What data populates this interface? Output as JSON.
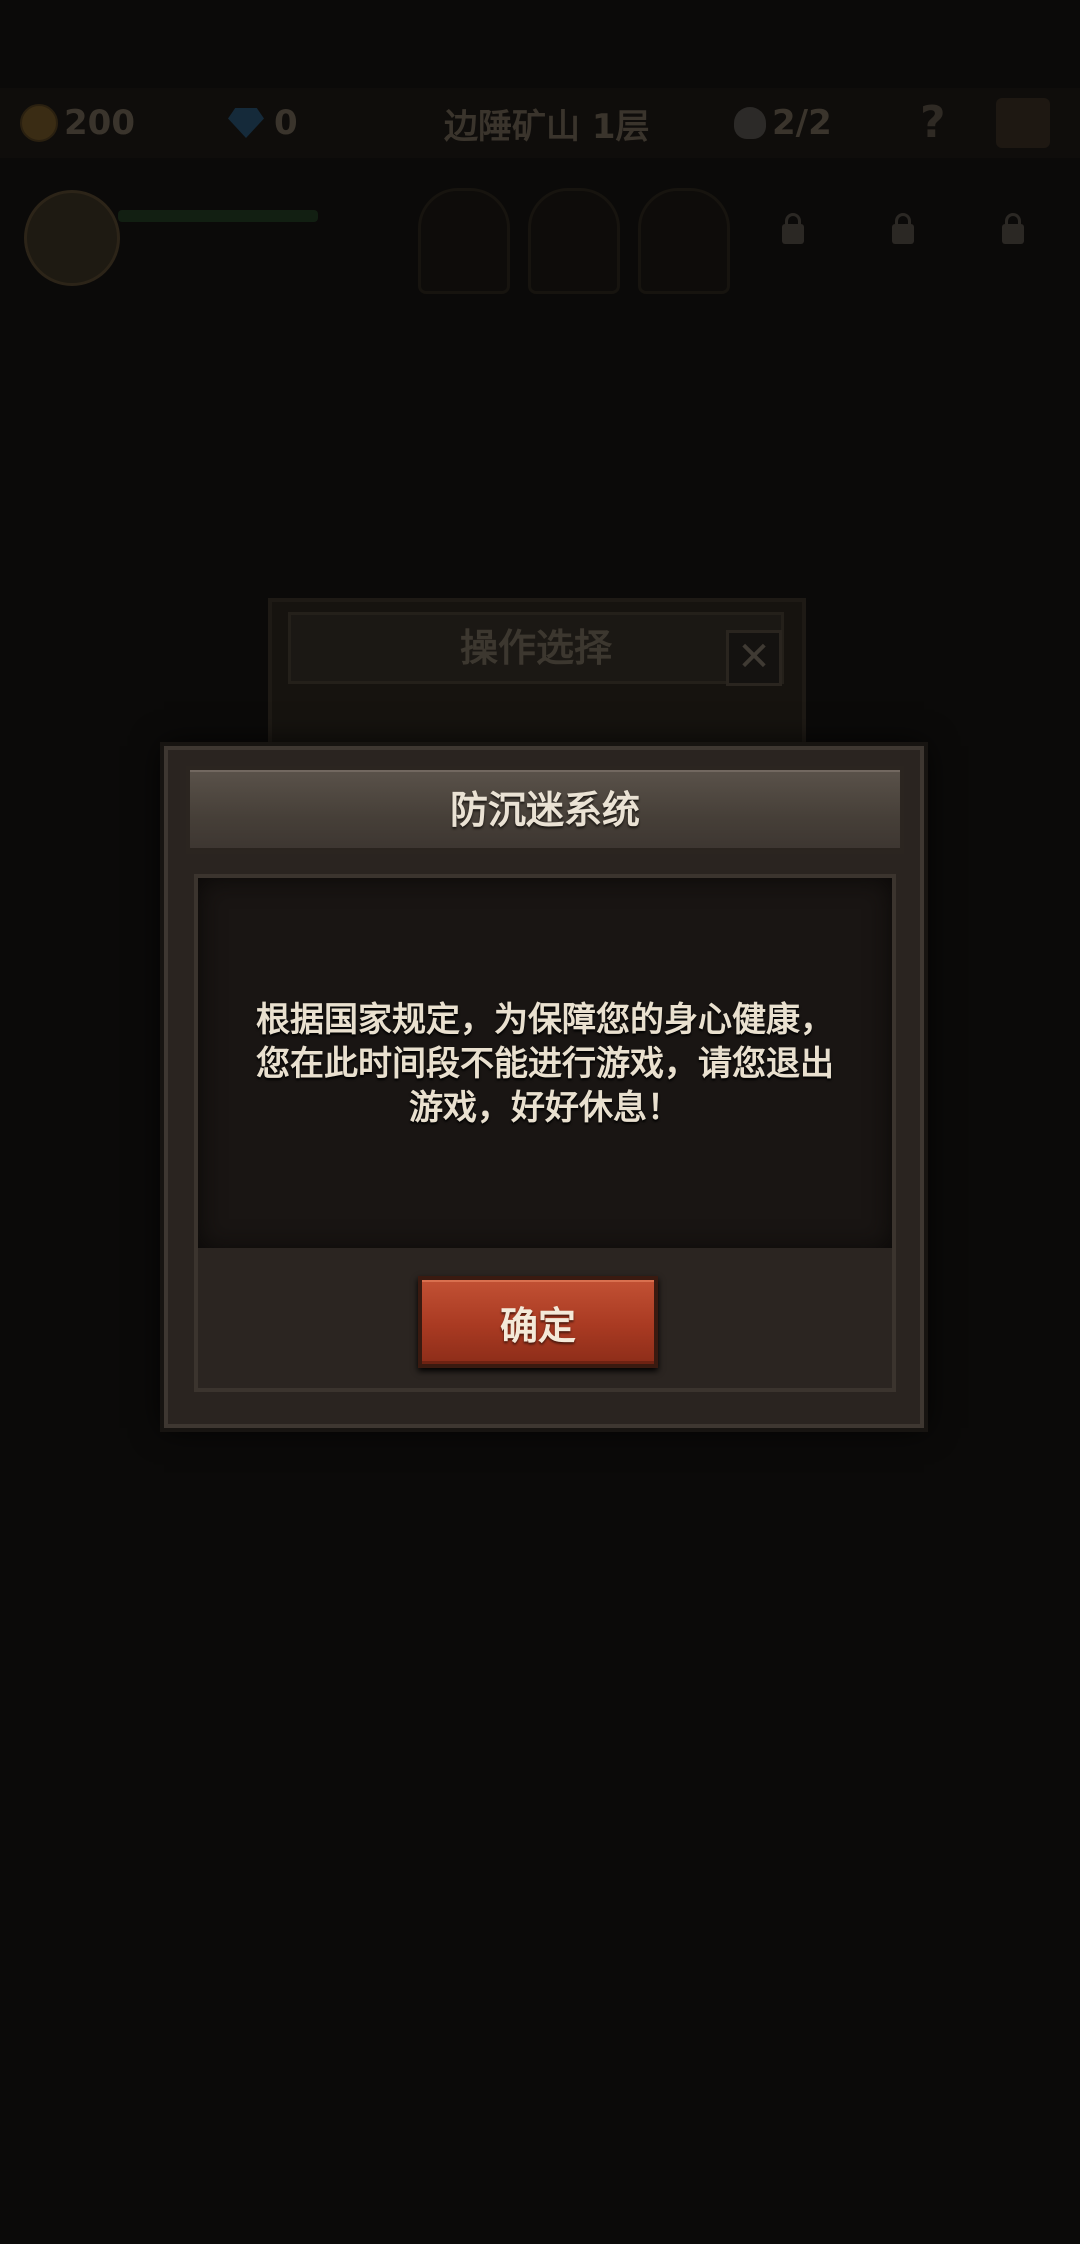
{
  "topbar": {
    "gold": "200",
    "gems": "0",
    "location": "边陲矿山 1层",
    "party": "2/2",
    "help": "?"
  },
  "background_dialog": {
    "title": "操作选择",
    "close": "✕"
  },
  "modal": {
    "title": "防沉迷系统",
    "message": "根据国家规定，为保障您的身心健康，您在此时间段不能进行游戏，请您退出游戏，好好休息！",
    "confirm_label": "确定"
  },
  "colors": {
    "confirm_button": "#a93a22",
    "modal_frame": "#2a2420",
    "text": "#e9e0cf"
  }
}
